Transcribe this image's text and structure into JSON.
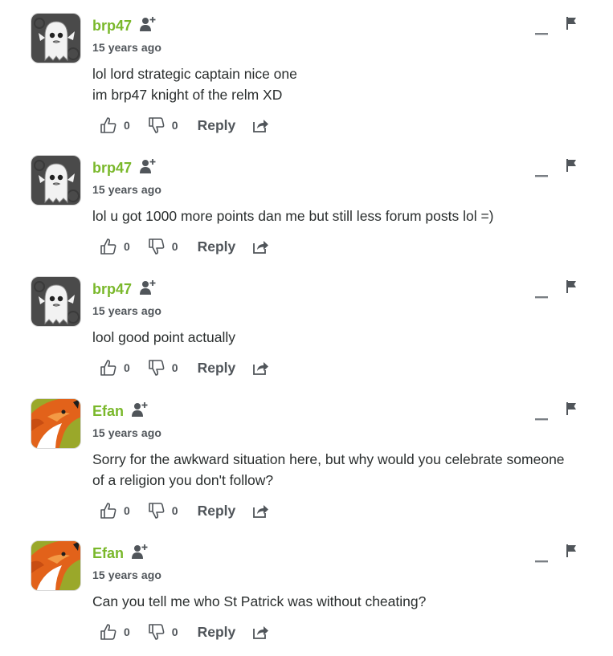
{
  "comments": [
    {
      "author": "brp47",
      "time": "15 years ago",
      "lines": [
        "lol lord strategic captain nice one",
        "im brp47 knight of the relm XD"
      ],
      "likes": "0",
      "dislikes": "0",
      "reply_label": "Reply",
      "avatar": "ghost-avatar"
    },
    {
      "author": "brp47",
      "time": "15 years ago",
      "lines": [
        "lol u got 1000 more points dan me but still less forum posts lol =)"
      ],
      "likes": "0",
      "dislikes": "0",
      "reply_label": "Reply",
      "avatar": "ghost-avatar"
    },
    {
      "author": "brp47",
      "time": "15 years ago",
      "lines": [
        "lool good point actually"
      ],
      "likes": "0",
      "dislikes": "0",
      "reply_label": "Reply",
      "avatar": "ghost-avatar"
    },
    {
      "author": "Efan",
      "time": "15 years ago",
      "lines": [
        "Sorry for the awkward situation here, but why would you celebrate someone",
        "of a religion you don't follow?"
      ],
      "likes": "0",
      "dislikes": "0",
      "reply_label": "Reply",
      "avatar": "fox-avatar"
    },
    {
      "author": "Efan",
      "time": "15 years ago",
      "lines": [
        "Can you tell me who St Patrick was without cheating?"
      ],
      "likes": "0",
      "dislikes": "0",
      "reply_label": "Reply",
      "avatar": "fox-avatar"
    }
  ],
  "colors": {
    "author": "#7ab82b",
    "text": "#2a2e2e",
    "muted": "#50555a"
  }
}
